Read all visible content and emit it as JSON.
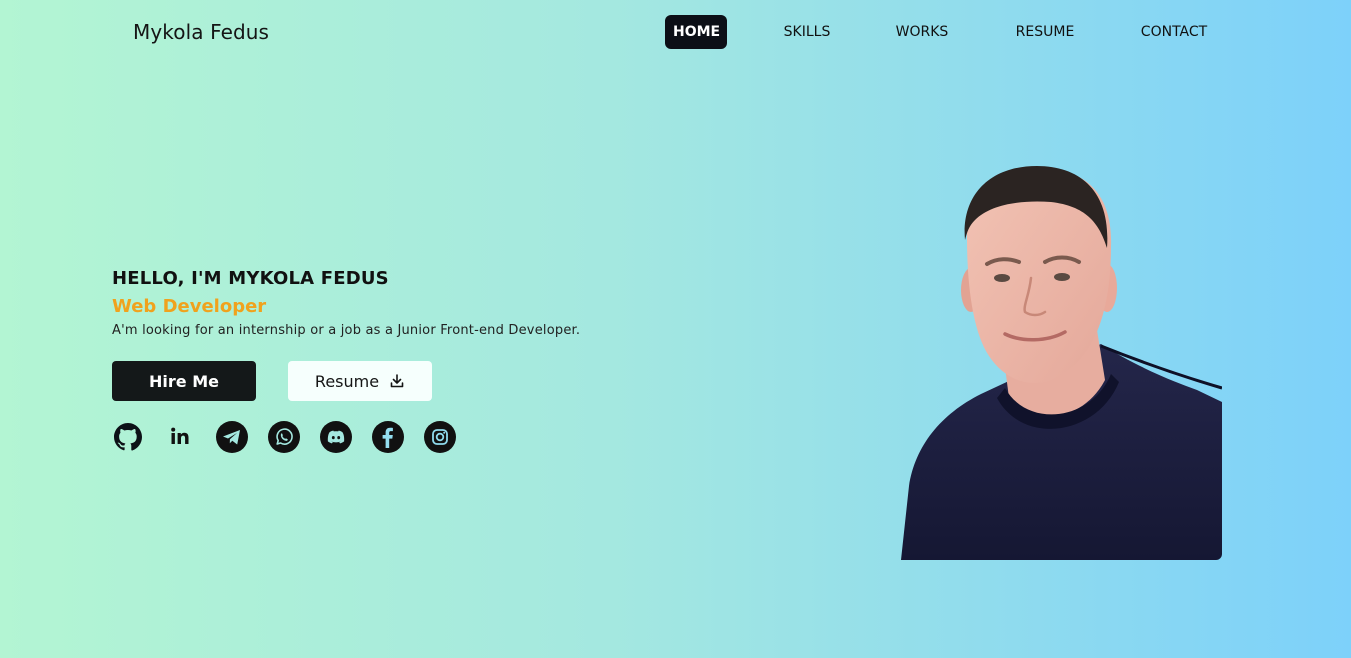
{
  "header": {
    "logo": "Mykola Fedus",
    "nav": [
      {
        "label": "HOME",
        "active": true
      },
      {
        "label": "SKILLS"
      },
      {
        "label": "WORKS"
      },
      {
        "label": "RESUME"
      },
      {
        "label": "CONTACT"
      }
    ]
  },
  "hero": {
    "title": "HELLO, I'M MYKOLA FEDUS",
    "subtitle": "Web Developer",
    "description": "A'm looking for an internship or a job as a Junior Front-end Developer.",
    "hire_label": "Hire Me",
    "resume_label": "Resume",
    "socials": [
      "github-icon",
      "linkedin-icon",
      "telegram-icon",
      "whatsapp-icon",
      "discord-icon",
      "facebook-icon",
      "instagram-icon"
    ]
  },
  "colors": {
    "accent": "#f0a21d",
    "dark": "#0c0f16",
    "gradient_start": "#b3f5d3",
    "gradient_end": "#7dd1fa"
  }
}
